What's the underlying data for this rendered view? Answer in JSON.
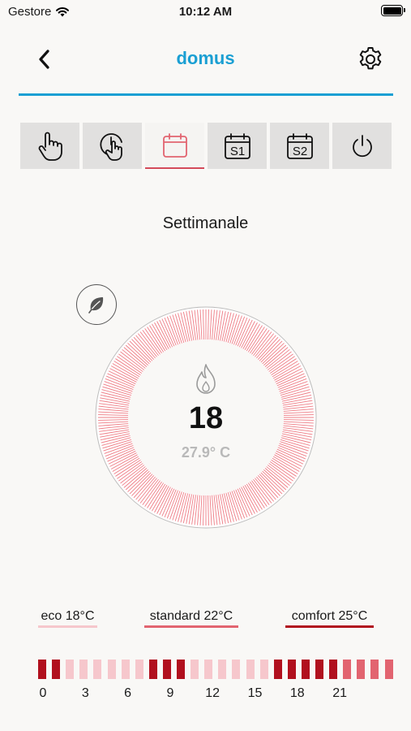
{
  "status_bar": {
    "carrier": "Gestore",
    "time": "10:12 AM",
    "wifi_icon": "wifi-icon",
    "battery_icon": "battery-icon"
  },
  "nav": {
    "title": "domus",
    "back_icon": "chevron-left-icon",
    "settings_icon": "gear-icon"
  },
  "modes": [
    {
      "name": "manual",
      "icon": "hand-pointer-icon",
      "label": ""
    },
    {
      "name": "timer",
      "icon": "hand-clock-icon",
      "label": ""
    },
    {
      "name": "weekly",
      "icon": "calendar-icon",
      "label": "",
      "active": true
    },
    {
      "name": "s1",
      "icon": "calendar-s1-icon",
      "label": "S1"
    },
    {
      "name": "s2",
      "icon": "calendar-s2-icon",
      "label": "S2"
    },
    {
      "name": "off",
      "icon": "power-icon",
      "label": ""
    }
  ],
  "mode_label": "Settimanale",
  "eco_badge_icon": "leaf-icon",
  "thermostat": {
    "setpoint": "18",
    "current": "27.9° C",
    "flame_icon": "flame-icon"
  },
  "legend": [
    {
      "label": "eco 18°C",
      "color": "#f6c7cc"
    },
    {
      "label": "standard 22°C",
      "color": "#e26470"
    },
    {
      "label": "comfort 25°C",
      "color": "#b1101e"
    }
  ],
  "schedule": {
    "slots": [
      "comfort",
      "comfort",
      "eco",
      "eco",
      "eco",
      "eco",
      "eco",
      "eco",
      "comfort",
      "comfort",
      "comfort",
      "eco",
      "eco",
      "eco",
      "eco",
      "eco",
      "eco",
      "comfort",
      "comfort",
      "comfort",
      "comfort",
      "comfort",
      "standard",
      "standard",
      "standard",
      "standard"
    ],
    "hour_labels": [
      "0",
      "3",
      "6",
      "9",
      "12",
      "15",
      "18",
      "21"
    ]
  },
  "colors": {
    "accent": "#1a9fd3",
    "eco": "#f6c7cc",
    "standard": "#e26470",
    "comfort": "#b1101e",
    "dial_ring": "#e8505c"
  }
}
